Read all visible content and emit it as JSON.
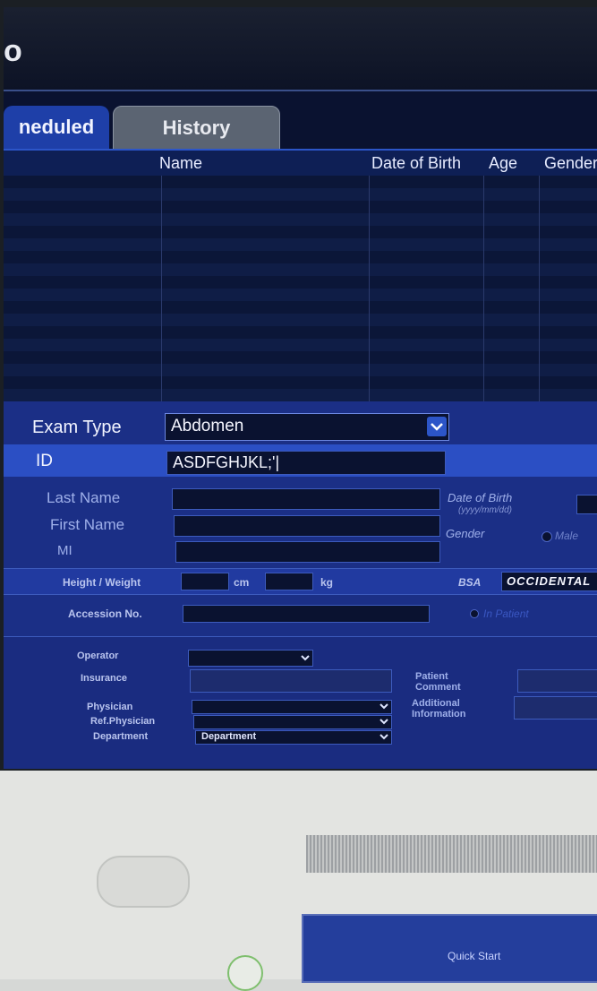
{
  "header": {
    "logo": "o"
  },
  "tabs": [
    {
      "label": "neduled"
    },
    {
      "label": "History"
    }
  ],
  "worklist": {
    "columns": {
      "name": "Name",
      "dob": "Date of Birth",
      "age": "Age",
      "gender": "Gender"
    }
  },
  "form": {
    "exam_type": {
      "label": "Exam Type",
      "value": "Abdomen"
    },
    "id": {
      "label": "ID",
      "value": "ASDFGHJKL;'|"
    },
    "last_name": {
      "label": "Last Name"
    },
    "first_name": {
      "label": "First Name"
    },
    "mi": {
      "label": "MI"
    },
    "dob": {
      "label": "Date of Birth",
      "hint": "(yyyy/mm/dd)"
    },
    "gender": {
      "label": "Gender",
      "option_male": "Male"
    },
    "height_weight": {
      "label": "Height / Weight",
      "cm": "cm",
      "kg": "kg"
    },
    "bsa": {
      "label": "BSA",
      "value": "OCCIDENTAL"
    },
    "accession": {
      "label": "Accession No."
    },
    "in_patient": {
      "label": "In Patient"
    },
    "operator": {
      "label": "Operator"
    },
    "insurance": {
      "label": "Insurance"
    },
    "physician": {
      "label": "Physician"
    },
    "ref_physician": {
      "label": "Ref.Physician"
    },
    "department": {
      "label": "Department",
      "value": "Department"
    },
    "patient_comment": {
      "label": "Patient\nComment"
    },
    "additional_info": {
      "label": "Additional\nInformation"
    }
  },
  "console": {
    "quick_start": "Quick Start"
  },
  "colors": {
    "screen_bg": "#0a1230",
    "form_bg": "#1b2f86",
    "tab_active": "#1e3fa8",
    "accent_border": "#2c55c8"
  }
}
